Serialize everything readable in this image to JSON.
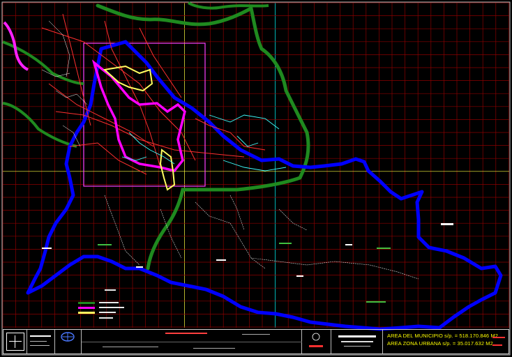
{
  "colors": {
    "background": "#000000",
    "grid": "#8b0000",
    "grid_accent_yellow": "#ffff40",
    "grid_accent_cyan": "#00ffff",
    "municipal_boundary": "#0000ff",
    "rural_boundary": "#1f8a1f",
    "urban_zone": "#ff00ff",
    "urban_area": "#ffff60",
    "roads": "#ff3030",
    "rivers": "#40ffff",
    "paths": "#ffffff",
    "area_text": "#ffff00"
  },
  "drawing": {
    "icons": [
      "gear-icon",
      "grid-icon",
      "logo-icon"
    ]
  },
  "title_block": {
    "area_municipio": "AREA DEL MUNICIPIO s/p. = 518.170.846 M2",
    "area_urbana": "AREA ZONA URBANA s/p. = 35.017.632 M2"
  }
}
